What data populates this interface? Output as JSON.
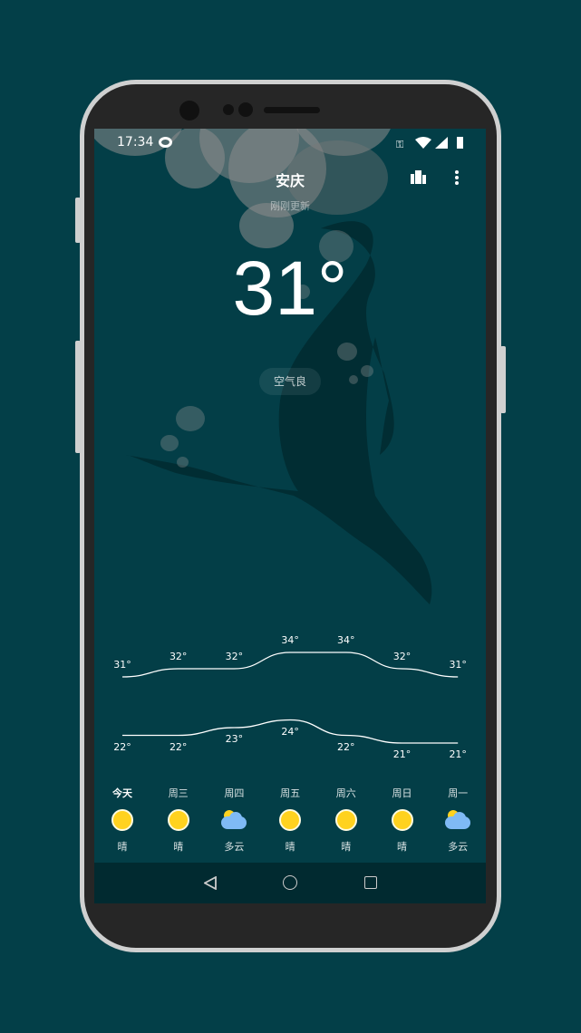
{
  "status_bar": {
    "time": "17:34",
    "icons": [
      "sync-icon",
      "vpn-key-icon",
      "wifi-icon",
      "signal-icon",
      "battery-icon"
    ]
  },
  "header": {
    "city": "安庆",
    "updated": "刚刚更新",
    "icons": [
      "city-icon",
      "more-vert-icon"
    ]
  },
  "current": {
    "temperature": "31°",
    "air_quality": "空气良"
  },
  "forecast": [
    {
      "day": "今天",
      "high": 31,
      "low": 22,
      "high_label": "31°",
      "low_label": "22°",
      "weather": "晴",
      "icon": "sunny"
    },
    {
      "day": "周三",
      "high": 32,
      "low": 22,
      "high_label": "32°",
      "low_label": "22°",
      "weather": "晴",
      "icon": "sunny"
    },
    {
      "day": "周四",
      "high": 32,
      "low": 23,
      "high_label": "32°",
      "low_label": "23°",
      "weather": "多云",
      "icon": "cloudy"
    },
    {
      "day": "周五",
      "high": 34,
      "low": 24,
      "high_label": "34°",
      "low_label": "24°",
      "weather": "晴",
      "icon": "sunny"
    },
    {
      "day": "周六",
      "high": 34,
      "low": 22,
      "high_label": "34°",
      "low_label": "22°",
      "weather": "晴",
      "icon": "sunny"
    },
    {
      "day": "周日",
      "high": 32,
      "low": 21,
      "high_label": "32°",
      "low_label": "21°",
      "weather": "晴",
      "icon": "sunny"
    },
    {
      "day": "周一",
      "high": 31,
      "low": 21,
      "high_label": "31°",
      "low_label": "21°",
      "weather": "多云",
      "icon": "cloudy"
    }
  ],
  "colors": {
    "background": "#033e47",
    "sun": "#ffd21f",
    "cloud": "#7fbaf5"
  }
}
